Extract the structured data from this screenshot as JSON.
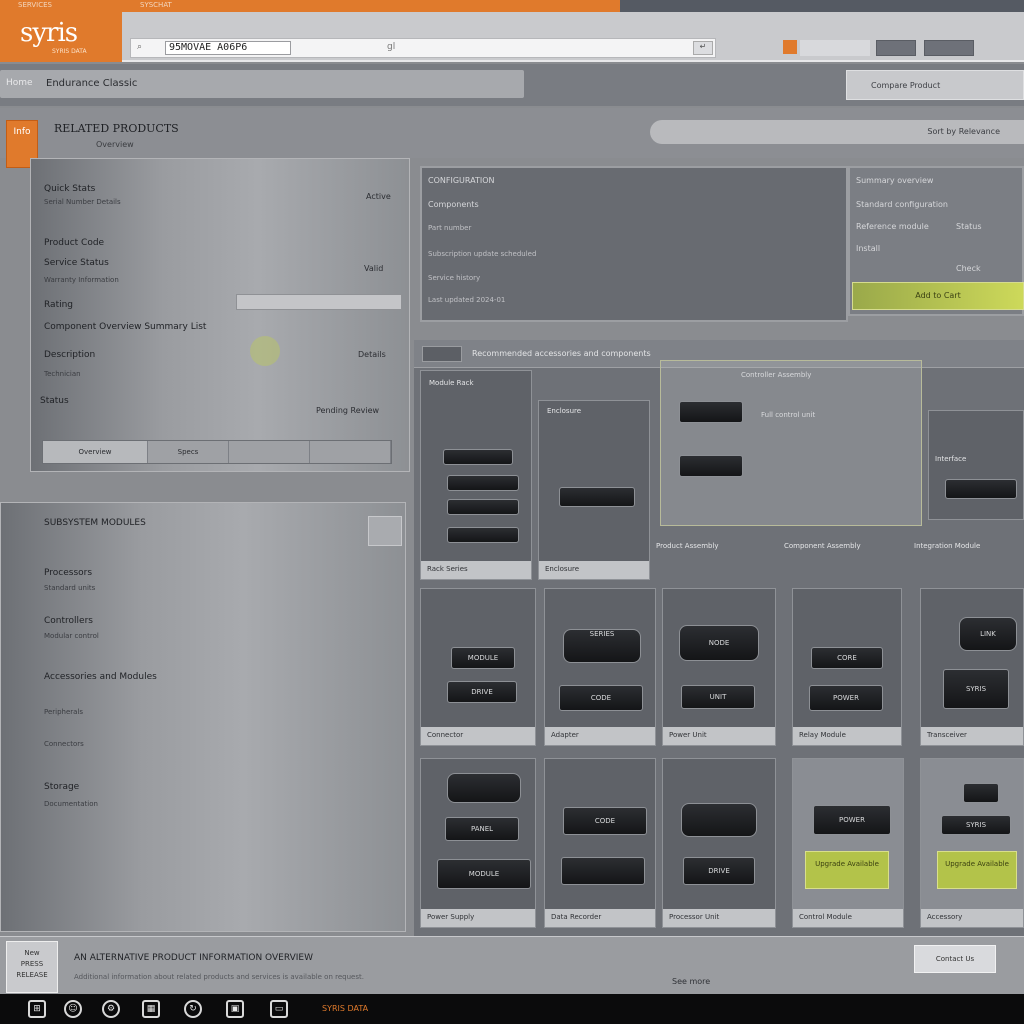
{
  "top_strip": {
    "left_text": "SERVICES",
    "mid_text": "SYSCHAT",
    "right_text": ""
  },
  "header": {
    "logo": "syris",
    "logo_sub": "SYRIS DATA",
    "search_icon": "search-icon",
    "search_value": "95MOVAE A06P6",
    "search_mid": "gl",
    "toolbar_buttons": [
      "",
      ""
    ],
    "accent_color": "#e07a2c"
  },
  "nav": {
    "home": "Home",
    "breadcrumb": "Endurance Classic",
    "right_label": "Compare Product"
  },
  "title": {
    "icon_text": "Info",
    "main": "RELATED PRODUCTS",
    "sub": "Overview",
    "filter_label": "Sort by Relevance"
  },
  "sidebar_a": {
    "rows": [
      {
        "label": "Quick Stats",
        "value": ""
      },
      {
        "label": "Serial Number Details",
        "value": "Active"
      },
      {
        "label": "Product Code",
        "value": ""
      },
      {
        "label": "Service Status",
        "value": ""
      },
      {
        "label": "Warranty Information",
        "value": "Valid"
      },
      {
        "label": "Rating",
        "value": ""
      },
      {
        "label": "Component Overview Summary List",
        "value": ""
      },
      {
        "label": "Description",
        "value": "Details"
      },
      {
        "label": "Technician",
        "value": ""
      },
      {
        "label": "Status",
        "value": "Pending Review"
      }
    ],
    "segments": [
      "Overview",
      "Specs",
      "",
      ""
    ]
  },
  "sidebar_b": {
    "title": "SUBSYSTEM MODULES",
    "sections": [
      {
        "head": "Processors",
        "sub": "Standard units"
      },
      {
        "head": "Controllers",
        "sub": "Modular control"
      },
      {
        "head": "Accessories and Modules",
        "sub": ""
      },
      {
        "head": "Peripherals",
        "sub": ""
      },
      {
        "head": "Connectors",
        "sub": ""
      },
      {
        "head": "Storage",
        "sub": ""
      },
      {
        "head": "Documentation",
        "sub": ""
      }
    ]
  },
  "info_a": {
    "lines": [
      "CONFIGURATION",
      "Components",
      "Part number",
      "Subscription update scheduled",
      "Service history",
      "Last updated 2024-01"
    ]
  },
  "info_b": {
    "lines": [
      "Summary overview",
      "Standard configuration",
      "Reference module",
      "Install"
    ],
    "values": [
      "",
      "Status",
      "Check"
    ],
    "button": "Add to Cart"
  },
  "grid": {
    "header": "Recommended accessories and components",
    "cards_row1": [
      {
        "cap": "Module Rack",
        "label": "Rack Series"
      },
      {
        "cap": "Enclosure",
        "label": "Enclosure"
      },
      {
        "cap": "Controller Assembly",
        "label": "Full control unit"
      },
      {
        "cap": "Interface",
        "label": ""
      }
    ],
    "captions_mid": [
      "Product Assembly",
      "Component Assembly",
      "Integration Module"
    ],
    "cards_row2": [
      {
        "label": "Connector"
      },
      {
        "label": "Adapter"
      },
      {
        "label": "Power Unit"
      },
      {
        "label": "Relay Module"
      },
      {
        "label": "Transceiver"
      }
    ],
    "devices_row2": [
      "MODULE",
      "DRIVE",
      "SERIES",
      "CODE",
      "NODE",
      "UNIT",
      "CORE",
      "POWER",
      "LINK",
      "SYRIS"
    ],
    "cards_row3": [
      {
        "label": "Power Supply"
      },
      {
        "label": "Data Recorder"
      },
      {
        "label": "Processor Unit"
      },
      {
        "label": "Control Module"
      },
      {
        "label": "Accessory"
      }
    ],
    "devices_row3": [
      "PANEL",
      "MODULE",
      "CODE",
      "DRIVE",
      "POWER",
      "SYRIS"
    ],
    "lime_panels": [
      "Upgrade Available",
      "Upgrade Available"
    ]
  },
  "bottom": {
    "promo": [
      "New",
      "PRESS",
      "RELEASE"
    ],
    "title": "AN ALTERNATIVE PRODUCT INFORMATION OVERVIEW",
    "sub": "Additional information about related products and services is available on request.",
    "sub2": "See more",
    "button": "Contact Us"
  },
  "taskbar": {
    "icons": [
      "windows-icon",
      "people-icon",
      "gear-icon",
      "chip-icon",
      "refresh-icon",
      "cpu-icon",
      "monitor-icon"
    ],
    "text": "SYRIS DATA"
  }
}
